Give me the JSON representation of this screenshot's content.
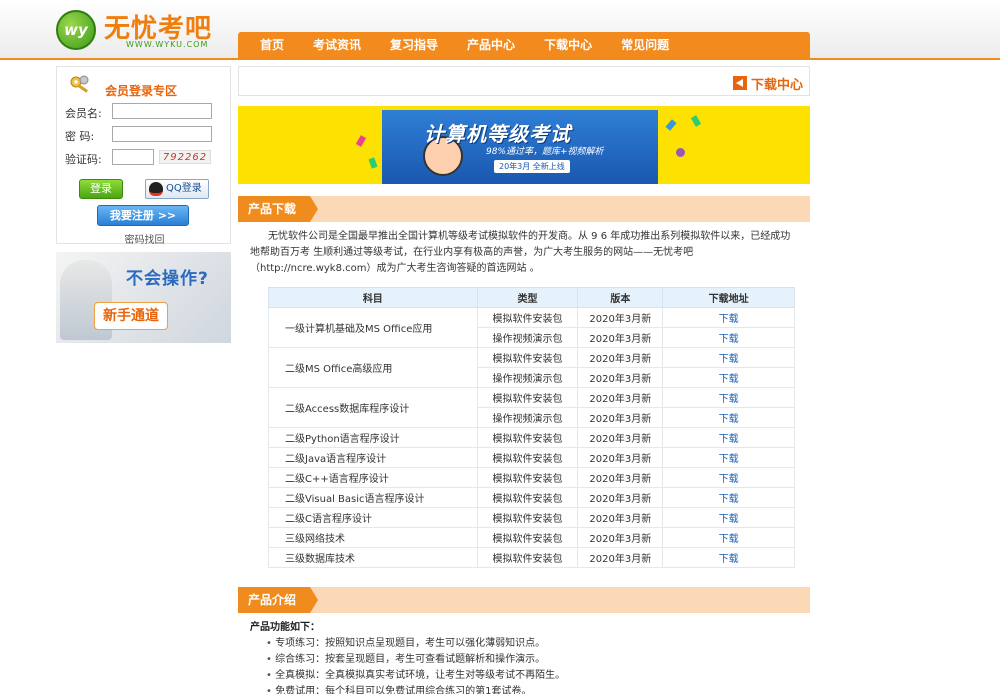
{
  "brand": {
    "logo_initials": "wy",
    "name": "无忧考吧",
    "domain": "WWW.WYKU.COM",
    "accent": "#f08c1e",
    "green": "#4aa510"
  },
  "nav": [
    "首页",
    "考试资讯",
    "复习指导",
    "产品中心",
    "下载中心",
    "常见问题"
  ],
  "login": {
    "title": "会员登录专区",
    "username_label": "会员名:",
    "password_label": "密 码:",
    "captcha_label": "验证码:",
    "captcha_value": "792262",
    "login_button": "登录",
    "qq_button": "QQ登录",
    "register_button": "我要注册 >>",
    "forgot_link": "密码找回"
  },
  "newbie": {
    "question": "不会操作?",
    "tag": "新手通道"
  },
  "download_header": {
    "title": "下载中心"
  },
  "banner": {
    "title": "计算机等级考试",
    "subtitle": "98%通过率，题库+视频解析",
    "date_label": "20年3月 全新上线"
  },
  "product_download": {
    "section_title": "产品下载",
    "intro": "无忧软件公司是全国最早推出全国计算机等级考试模拟软件的开发商。从 9 6 年成功推出系列模拟软件以来，已经成功地帮助百万考 生顺利通过等级考试，在行业内享有极高的声誉，为广大考生服务的网站——无忧考吧（http://ncre.wyk8.com）成为广大考生咨询答疑的首选网站 。",
    "table": {
      "headers": [
        "科目",
        "类型",
        "版本",
        "下载地址"
      ],
      "groups": [
        {
          "subject": "一级计算机基础及MS Office应用",
          "rows": [
            {
              "type": "模拟软件安装包",
              "version": "2020年3月新",
              "link": "下载"
            },
            {
              "type": "操作视频演示包",
              "version": "2020年3月新",
              "link": "下载"
            }
          ]
        },
        {
          "subject": "二级MS Office高级应用",
          "rows": [
            {
              "type": "模拟软件安装包",
              "version": "2020年3月新",
              "link": "下载"
            },
            {
              "type": "操作视频演示包",
              "version": "2020年3月新",
              "link": "下载"
            }
          ]
        },
        {
          "subject": "二级Access数据库程序设计",
          "rows": [
            {
              "type": "模拟软件安装包",
              "version": "2020年3月新",
              "link": "下载"
            },
            {
              "type": "操作视频演示包",
              "version": "2020年3月新",
              "link": "下载"
            }
          ]
        },
        {
          "subject": "二级Python语言程序设计",
          "rows": [
            {
              "type": "模拟软件安装包",
              "version": "2020年3月新",
              "link": "下载"
            }
          ]
        },
        {
          "subject": "二级Java语言程序设计",
          "rows": [
            {
              "type": "模拟软件安装包",
              "version": "2020年3月新",
              "link": "下载"
            }
          ]
        },
        {
          "subject": "二级C++语言程序设计",
          "rows": [
            {
              "type": "模拟软件安装包",
              "version": "2020年3月新",
              "link": "下载"
            }
          ]
        },
        {
          "subject": "二级Visual Basic语言程序设计",
          "rows": [
            {
              "type": "模拟软件安装包",
              "version": "2020年3月新",
              "link": "下载"
            }
          ]
        },
        {
          "subject": "二级C语言程序设计",
          "rows": [
            {
              "type": "模拟软件安装包",
              "version": "2020年3月新",
              "link": "下载"
            }
          ]
        },
        {
          "subject": "三级网络技术",
          "rows": [
            {
              "type": "模拟软件安装包",
              "version": "2020年3月新",
              "link": "下载"
            }
          ]
        },
        {
          "subject": "三级数据库技术",
          "rows": [
            {
              "type": "模拟软件安装包",
              "version": "2020年3月新",
              "link": "下载"
            }
          ]
        }
      ]
    }
  },
  "product_intro": {
    "section_title": "产品介绍",
    "features_title": "产品功能如下：",
    "features": [
      "专项练习：按照知识点呈现题目，考生可以强化薄弱知识点。",
      "综合练习：按套呈现题目，考生可查看试题解析和操作演示。",
      "全真模拟：全真模拟真实考试环境，让考生对等级考试不再陌生。",
      "免费试用：每个科目可以免费试用综合练习的第1套试卷。"
    ]
  }
}
